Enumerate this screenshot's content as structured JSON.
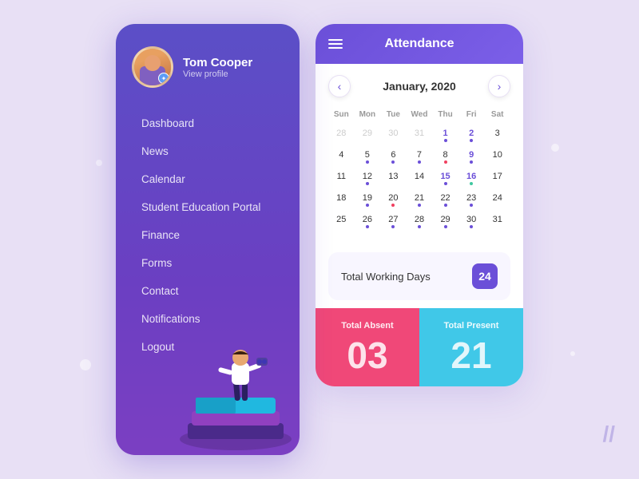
{
  "app": {
    "background": "#e8e0f5"
  },
  "left_panel": {
    "user": {
      "name": "Tom Cooper",
      "view_profile_label": "View profile"
    },
    "nav_items": [
      {
        "label": "Dashboard",
        "id": "dashboard"
      },
      {
        "label": "News",
        "id": "news"
      },
      {
        "label": "Calendar",
        "id": "calendar"
      },
      {
        "label": "Student Education Portal",
        "id": "student-education-portal"
      },
      {
        "label": "Finance",
        "id": "finance"
      },
      {
        "label": "Forms",
        "id": "forms"
      },
      {
        "label": "Contact",
        "id": "contact"
      },
      {
        "label": "Notifications",
        "id": "notifications"
      },
      {
        "label": "Logout",
        "id": "logout"
      }
    ]
  },
  "right_panel": {
    "header": {
      "title": "Attendance"
    },
    "calendar": {
      "month_label": "January, 2020",
      "day_names": [
        "Sun",
        "Mon",
        "Tue",
        "Wed",
        "Thu",
        "Fri",
        "Sat"
      ],
      "prev_arrow": "‹",
      "next_arrow": "›"
    },
    "total_working": {
      "label": "Total Working Days",
      "value": "24"
    },
    "stats": {
      "absent": {
        "label": "Total Absent",
        "value": "03"
      },
      "present": {
        "label": "Total Present",
        "value": "21"
      }
    }
  }
}
